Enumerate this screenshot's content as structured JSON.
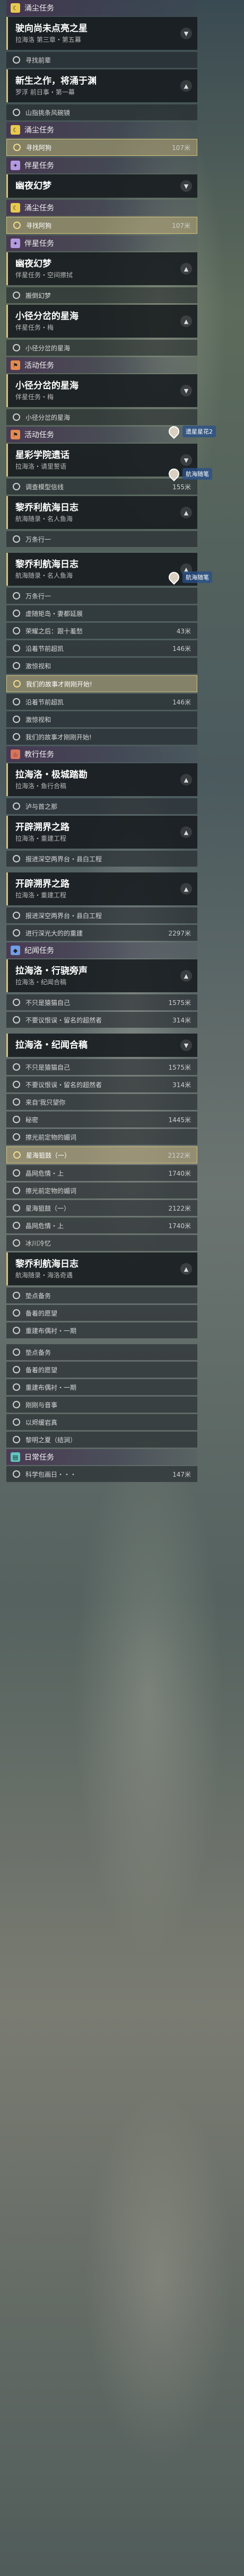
{
  "groups": [
    {
      "kind": "category",
      "color": "yellow",
      "icon": "crescent-icon",
      "label": "涌尘任务"
    },
    {
      "kind": "quest",
      "title": "驶向尚未点亮之星",
      "sub": "拉海洛 第三章・第五幕",
      "open": false
    },
    {
      "kind": "obj",
      "label": "寻找前辈"
    },
    {
      "kind": "quest",
      "title": "新生之作，将涌于渊",
      "sub": "罗浮 前日事・第一幕",
      "open": true
    },
    {
      "kind": "obj",
      "label": "山指挑条风碗镜"
    },
    {
      "kind": "category",
      "color": "yellow",
      "icon": "crescent-icon",
      "label": "涌尘任务"
    },
    {
      "kind": "obj",
      "label": "寻找阿狗",
      "dist": "107米",
      "highlight": true
    },
    {
      "kind": "category",
      "color": "purple",
      "icon": "star-icon",
      "label": "伴星任务"
    },
    {
      "kind": "quest",
      "title": "幽夜幻梦",
      "sub": "",
      "open": false
    },
    {
      "kind": "category",
      "color": "yellow",
      "icon": "crescent-icon",
      "label": "涌尘任务"
    },
    {
      "kind": "obj",
      "label": "寻找阿狗",
      "dist": "107米",
      "highlight": true
    },
    {
      "kind": "category",
      "color": "purple",
      "icon": "star-icon",
      "label": "伴星任务"
    },
    {
      "kind": "quest",
      "title": "幽夜幻梦",
      "sub": "伴星任务・空间擦拭",
      "open": true
    },
    {
      "kind": "obj",
      "label": "搬倒幻梦"
    },
    {
      "kind": "quest",
      "title": "小径分岔的星海",
      "sub": "伴星任务・梅",
      "open": true
    },
    {
      "kind": "obj",
      "label": "小径分岔的星海"
    },
    {
      "kind": "category",
      "color": "orange",
      "icon": "flag-icon",
      "label": "活动任务"
    },
    {
      "kind": "quest",
      "title": "小径分岔的星海",
      "sub": "伴星任务・梅",
      "open": false
    },
    {
      "kind": "obj",
      "label": "小径分岔的星海"
    },
    {
      "kind": "category",
      "color": "orange",
      "icon": "flag-icon",
      "label": "活动任务"
    },
    {
      "kind": "quest",
      "title": "星彩学院遗话",
      "sub": "拉海洛・请里誓语",
      "open": false
    },
    {
      "kind": "obj",
      "label": "调查模型信线",
      "dist": "155米"
    },
    {
      "kind": "quest",
      "title": "黎乔利航海日志",
      "sub": "航海随录・名人鱼海",
      "open": true
    },
    {
      "kind": "obj",
      "label": "万条行一"
    },
    {
      "kind": "spacer"
    },
    {
      "kind": "quest",
      "title": "黎乔利航海日志",
      "sub": "航海随录・名人鱼海",
      "open": true
    },
    {
      "kind": "obj",
      "label": "万条行一"
    },
    {
      "kind": "obj",
      "label": "虚随矩岛・妻都延展"
    },
    {
      "kind": "obj",
      "label": "荣耀之后：跟十羞愁",
      "dist": "43米"
    },
    {
      "kind": "obj",
      "label": "沿着节前超凯",
      "dist": "146米"
    },
    {
      "kind": "obj",
      "label": "激惊视和"
    },
    {
      "kind": "obj",
      "label": "我们的故事才刚刚开始!",
      "highlight": true
    },
    {
      "kind": "obj",
      "label": "沿着节前超凯",
      "dist": "146米"
    },
    {
      "kind": "obj",
      "label": "激惊视和"
    },
    {
      "kind": "obj",
      "label": "我们的故事才刚刚开始!"
    },
    {
      "kind": "category",
      "color": "red",
      "icon": "flame-icon",
      "label": "教行任务"
    },
    {
      "kind": "quest",
      "title": "拉海洛・极城踏勘",
      "sub": "拉海洛・鱼行合稿",
      "open": true
    },
    {
      "kind": "obj",
      "label": "泸与首之那"
    },
    {
      "kind": "quest",
      "title": "开辟溯界之路",
      "sub": "拉海洛・重建工程",
      "open": true
    },
    {
      "kind": "obj",
      "label": "报进深空两界台・县白工程"
    },
    {
      "kind": "spacer"
    },
    {
      "kind": "quest",
      "title": "开辟溯界之路",
      "sub": "拉海洛・重建工程",
      "open": true
    },
    {
      "kind": "obj",
      "label": "报进深空两界台・县白工程"
    },
    {
      "kind": "obj",
      "label": "进行深光大的的重建",
      "dist": "2297米"
    },
    {
      "kind": "category",
      "color": "blue",
      "icon": "diamond-icon",
      "label": "纪闻任务"
    },
    {
      "kind": "quest",
      "title": "拉海洛・行骁旁声",
      "sub": "拉海洛・纪闻合稿",
      "open": true
    },
    {
      "kind": "obj",
      "label": "不只是猿猫自己",
      "dist": "1575米"
    },
    {
      "kind": "obj",
      "label": "不要议恨误・留名的超然者",
      "dist": "314米"
    },
    {
      "kind": "spacer"
    },
    {
      "kind": "quest",
      "title": "拉海洛・纪闻合稿",
      "sub": "",
      "open": false
    },
    {
      "kind": "obj",
      "label": "不只是猿猫自己",
      "dist": "1575米"
    },
    {
      "kind": "obj",
      "label": "不要议恨误・留名的超然者",
      "dist": "314米"
    },
    {
      "kind": "obj",
      "label": "来自'我只望你"
    },
    {
      "kind": "obj",
      "label": "秘密",
      "dist": "1445米"
    },
    {
      "kind": "obj",
      "label": "擦光前定物的媚词"
    },
    {
      "kind": "obj",
      "label": "星海狙鼓（一）",
      "dist": "2122米",
      "highlight": true
    },
    {
      "kind": "obj",
      "label": "晶网危情・上",
      "dist": "1740米"
    },
    {
      "kind": "obj",
      "label": "擦光前定物的媚词"
    },
    {
      "kind": "obj",
      "label": "星海狙鼓（一）",
      "dist": "2122米"
    },
    {
      "kind": "obj",
      "label": "晶网危情・上",
      "dist": "1740米"
    },
    {
      "kind": "obj",
      "label": "冰川冷忆"
    },
    {
      "kind": "quest",
      "title": "黎乔利航海日志",
      "sub": "航海随录・海洛奇遇",
      "open": true
    },
    {
      "kind": "obj",
      "label": "垫点备务"
    },
    {
      "kind": "obj",
      "label": "备着的愿望"
    },
    {
      "kind": "obj",
      "label": "重建布偶衬・一期"
    },
    {
      "kind": "spacer"
    },
    {
      "kind": "obj",
      "label": "垫点备务"
    },
    {
      "kind": "obj",
      "label": "备着的愿望"
    },
    {
      "kind": "obj",
      "label": "重建布偶衬・一期"
    },
    {
      "kind": "obj",
      "label": "刚刚与音事"
    },
    {
      "kind": "obj",
      "label": "以烬缓岩真"
    },
    {
      "kind": "obj",
      "label": "黎明之夏（结涧）"
    },
    {
      "kind": "category",
      "color": "teal",
      "icon": "clipboard-icon",
      "label": "日常任务"
    },
    {
      "kind": "obj",
      "label": "科学包画日・・・",
      "dist": "147米"
    }
  ],
  "markers": [
    {
      "label": "遗星星花2"
    },
    {
      "label": "航海随笔"
    },
    {
      "label": "航海随笔"
    }
  ]
}
